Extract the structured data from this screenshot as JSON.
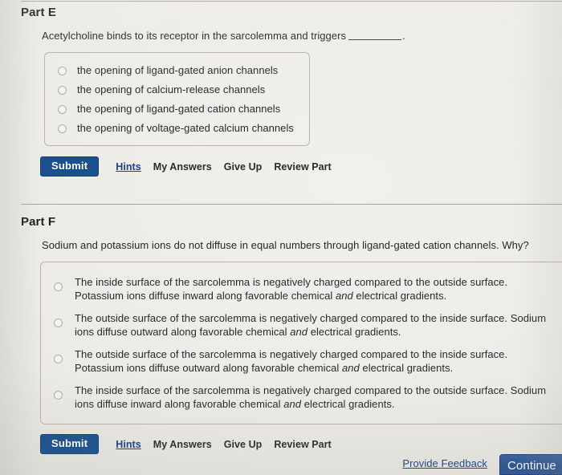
{
  "background_color": "#eceae6",
  "accent_color": "#1b508f",
  "link_color": "#1b3f88",
  "top_divider": true,
  "parts": [
    {
      "id": "part-e",
      "title": "Part E",
      "question_prefix": "Acetylcholine binds to its receptor in the sarcolemma and triggers",
      "question_suffix": ".",
      "has_blank": true,
      "options": [
        {
          "label": "the opening of ligand-gated anion channels",
          "selected": false
        },
        {
          "label": "the opening of calcium-release channels",
          "selected": false
        },
        {
          "label": "the opening of ligand-gated cation channels",
          "selected": false
        },
        {
          "label": "the opening of voltage-gated calcium channels",
          "selected": false
        }
      ],
      "actions": {
        "submit_label": "Submit",
        "links": [
          {
            "label": "Hints",
            "style": "link"
          },
          {
            "label": "My Answers",
            "style": "plain"
          },
          {
            "label": "Give Up",
            "style": "plain"
          },
          {
            "label": "Review Part",
            "style": "plain"
          }
        ]
      }
    },
    {
      "id": "part-f",
      "title": "Part F",
      "question_prefix": "Sodium and potassium ions do not diffuse in equal numbers through ligand-gated cation channels. Why?",
      "question_suffix": "",
      "has_blank": false,
      "options": [
        {
          "label_html": "The inside surface of the sarcolemma is negatively charged compared to the outside surface. Potassium ions diffuse inward along favorable chemical <i>and</i> electrical gradients.",
          "label": "The inside surface of the sarcolemma is negatively charged compared to the outside surface. Potassium ions diffuse inward along favorable chemical and electrical gradients.",
          "selected": false
        },
        {
          "label_html": "The outside surface of the sarcolemma is negatively charged compared to the inside surface. Sodium ions diffuse outward along favorable chemical <i>and</i> electrical gradients.",
          "label": "The outside surface of the sarcolemma is negatively charged compared to the inside surface. Sodium ions diffuse outward along favorable chemical and electrical gradients.",
          "selected": false
        },
        {
          "label_html": "The outside surface of the sarcolemma is negatively charged compared to the inside surface. Potassium ions diffuse outward along favorable chemical <i>and</i> electrical gradients.",
          "label": "The outside surface of the sarcolemma is negatively charged compared to the inside surface. Potassium ions diffuse outward along favorable chemical and electrical gradients.",
          "selected": false
        },
        {
          "label_html": "The inside surface of the sarcolemma is negatively charged compared to the outside surface. Sodium ions diffuse inward along favorable chemical <i>and</i> electrical gradients.",
          "label": "The inside surface of the sarcolemma is negatively charged compared to the outside surface. Sodium ions diffuse inward along favorable chemical and electrical gradients.",
          "selected": false
        }
      ],
      "actions": {
        "submit_label": "Submit",
        "links": [
          {
            "label": "Hints",
            "style": "link"
          },
          {
            "label": "My Answers",
            "style": "plain"
          },
          {
            "label": "Give Up",
            "style": "plain"
          },
          {
            "label": "Review Part",
            "style": "plain"
          }
        ]
      }
    }
  ],
  "footer": {
    "provide_feedback_label": "Provide Feedback",
    "continue_label": "Continue"
  }
}
